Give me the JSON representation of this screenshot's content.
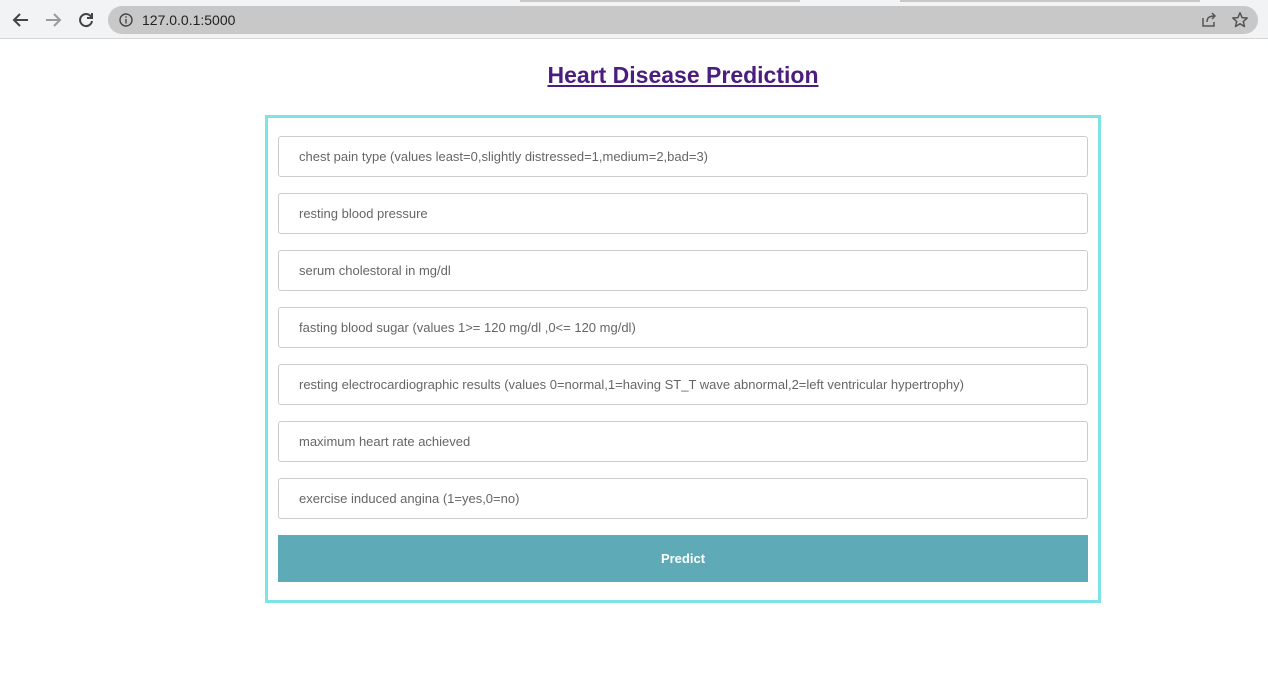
{
  "browser": {
    "url": "127.0.0.1:5000"
  },
  "page": {
    "title": "Heart Disease Prediction",
    "title_color": "#4b1d7f",
    "border_color": "#7de3e6",
    "button_color": "#5eabb7"
  },
  "form": {
    "fields": [
      {
        "placeholder": "chest pain type (values least=0,slightly distressed=1,medium=2,bad=3)",
        "value": ""
      },
      {
        "placeholder": "resting blood pressure",
        "value": ""
      },
      {
        "placeholder": "serum cholestoral in mg/dl",
        "value": ""
      },
      {
        "placeholder": "fasting blood sugar (values 1>= 120 mg/dl ,0<= 120 mg/dl)",
        "value": ""
      },
      {
        "placeholder": "resting electrocardiographic results (values 0=normal,1=having ST_T wave abnormal,2=left ventricular hypertrophy)",
        "value": ""
      },
      {
        "placeholder": "maximum heart rate achieved",
        "value": ""
      },
      {
        "placeholder": "exercise induced angina (1=yes,0=no)",
        "value": ""
      }
    ],
    "submit_label": "Predict"
  }
}
